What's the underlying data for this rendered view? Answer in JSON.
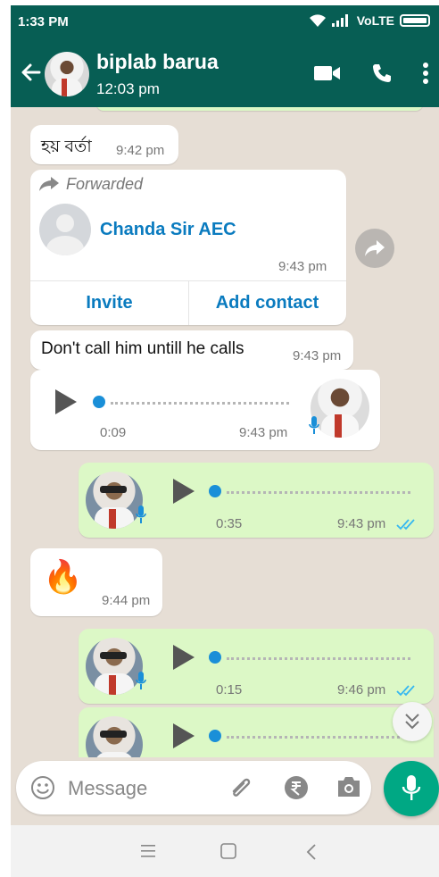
{
  "status_bar": {
    "time": "1:33 PM",
    "network": "VoLTE"
  },
  "header": {
    "contact_name": "biplab barua",
    "last_seen": "12:03 pm"
  },
  "messages": {
    "m1": {
      "text": "হয় বৰ্তা",
      "time": "9:42 pm"
    },
    "m2": {
      "forwarded_label": "Forwarded",
      "contact_card_name": "Chanda Sir AEC",
      "time": "9:43 pm",
      "invite_label": "Invite",
      "add_contact_label": "Add contact"
    },
    "m3": {
      "text": "Don't call him untill he calls",
      "time": "9:43 pm"
    },
    "m4": {
      "duration": "0:09",
      "time": "9:43 pm"
    },
    "m5": {
      "duration": "0:35",
      "time": "9:43 pm"
    },
    "m6": {
      "emoji": "🔥",
      "time": "9:44 pm"
    },
    "m7": {
      "duration": "0:15",
      "time": "9:46 pm"
    }
  },
  "composer": {
    "placeholder": "Message"
  },
  "colors": {
    "header": "#075e54",
    "accent": "#00a884",
    "outgoing": "#dcf8c6",
    "tick_read": "#34b7f1",
    "link": "#0a7bbf"
  }
}
